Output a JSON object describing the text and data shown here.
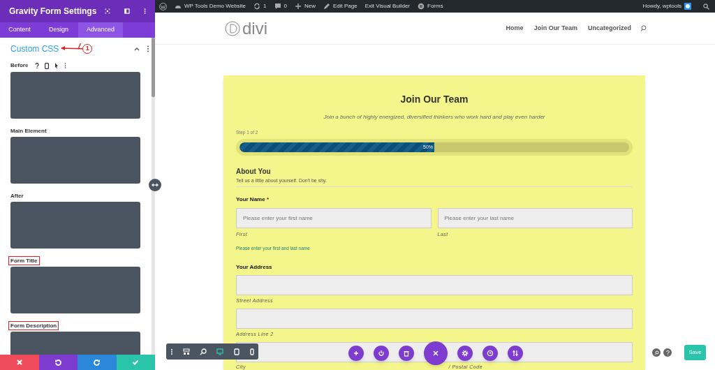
{
  "panel": {
    "title": "Gravity Form Settings",
    "tabs": [
      {
        "label": "Content",
        "selected": false
      },
      {
        "label": "Design",
        "selected": false
      },
      {
        "label": "Advanced",
        "selected": true
      }
    ],
    "section": {
      "title": "Custom CSS",
      "expanded": true,
      "annotation": "1"
    },
    "before_label": "Before",
    "css_fields": [
      {
        "label": "Main Element",
        "highlighted": false
      },
      {
        "label": "After",
        "highlighted": false
      },
      {
        "label": "Form Title",
        "highlighted": true
      },
      {
        "label": "Form Description",
        "highlighted": true
      }
    ],
    "footer": [
      {
        "kind": "discard"
      },
      {
        "kind": "undo"
      },
      {
        "kind": "redo"
      },
      {
        "kind": "save"
      }
    ]
  },
  "admin_bar": {
    "items": [
      {
        "kind": "site",
        "text": "WP Tools Demo Website"
      },
      {
        "kind": "updates",
        "text": "1"
      },
      {
        "kind": "comments",
        "text": "0"
      },
      {
        "kind": "new",
        "text": "New"
      },
      {
        "kind": "edit",
        "text": "Edit Page"
      },
      {
        "kind": "plain",
        "text": "Exit Visual Builder"
      },
      {
        "kind": "forms",
        "text": "Forms"
      }
    ],
    "greeting": "Howdy, wptools"
  },
  "site": {
    "logo": "divi",
    "nav": [
      "Home",
      "Join Our Team",
      "Uncategorized"
    ]
  },
  "form": {
    "title": "Join Our Team",
    "description": "Join a bunch of highly energized, diversified thinkers who work hard and play even harder",
    "step": "Step 1 of 2",
    "progress": {
      "level": 0.5,
      "reading": "50%"
    },
    "section_title": "About You",
    "section_description": "Tell us a little about yourself. Don't be shy.",
    "name_label": "Your Name",
    "required_mark": "*",
    "name_fields": [
      {
        "placeholder": "Please enter your first name",
        "sublabel": "First"
      },
      {
        "placeholder": "Please enter your last name",
        "sublabel": "Last"
      }
    ],
    "name_hint": "Please enter your first and last name",
    "address_label": "Your Address",
    "address_sublabels": [
      "Street Address",
      "Address Line 2"
    ],
    "city_sublabels": [
      "City",
      "/ Postal Code"
    ]
  },
  "builder": {
    "save": "Save"
  }
}
